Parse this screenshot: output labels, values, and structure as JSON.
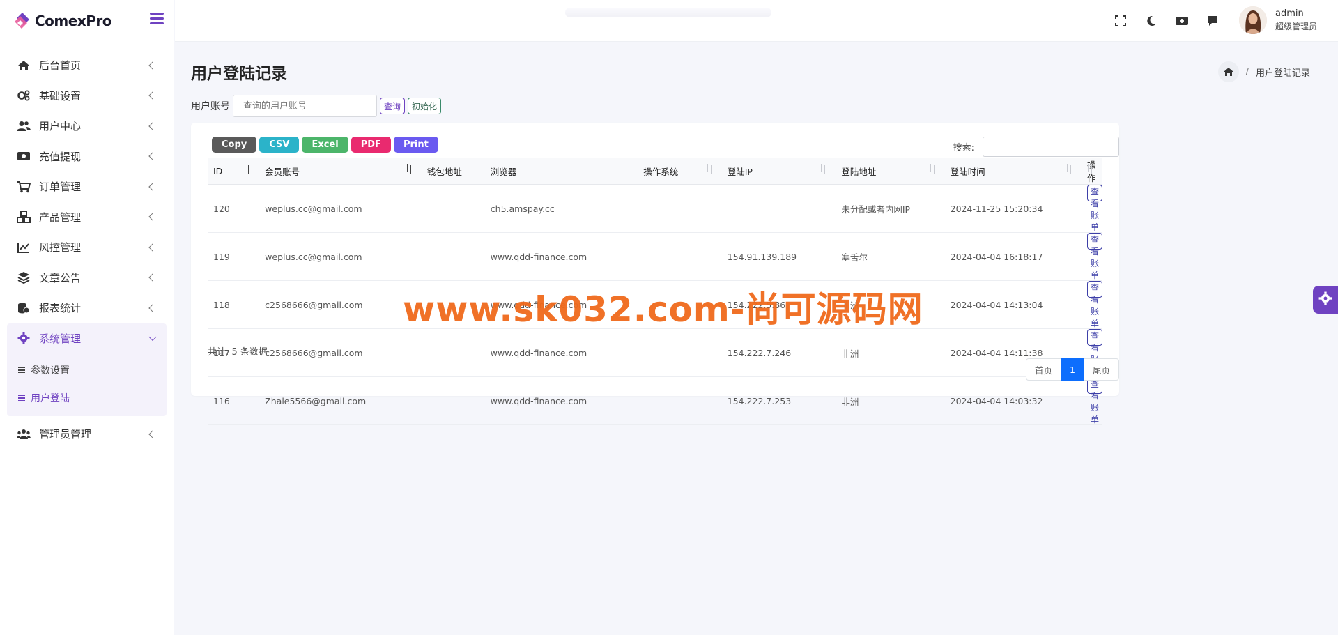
{
  "brand": {
    "name": "ComexPro"
  },
  "sidebar": {
    "items": [
      {
        "label": "后台首页",
        "icon": "home-icon"
      },
      {
        "label": "基础设置",
        "icon": "gears-icon"
      },
      {
        "label": "用户中心",
        "icon": "users-icon"
      },
      {
        "label": "充值提现",
        "icon": "money-icon"
      },
      {
        "label": "订单管理",
        "icon": "cart-icon"
      },
      {
        "label": "产品管理",
        "icon": "cubes-icon"
      },
      {
        "label": "风控管理",
        "icon": "chart-line-icon"
      },
      {
        "label": "文章公告",
        "icon": "layers-icon"
      },
      {
        "label": "报表统计",
        "icon": "coins-icon"
      },
      {
        "label": "系统管理",
        "icon": "gear-icon",
        "expanded": true
      },
      {
        "label": "管理员管理",
        "icon": "user-group-icon"
      }
    ],
    "submenu": [
      {
        "label": "参数设置"
      },
      {
        "label": "用户登陆",
        "selected": true
      }
    ]
  },
  "topbar": {
    "user": {
      "name": "admin",
      "role": "超级管理员"
    }
  },
  "page": {
    "title": "用户登陆记录",
    "breadcrumb": "用户登陆记录"
  },
  "filter": {
    "label": "用户账号",
    "placeholder": "查询的用户账号",
    "query_label": "查询",
    "reset_label": "初始化"
  },
  "toolbar": {
    "buttons": [
      {
        "label": "Copy",
        "color": "#5a5a5a"
      },
      {
        "label": "CSV",
        "color": "#2bb3c9"
      },
      {
        "label": "Excel",
        "color": "#4cb56a"
      },
      {
        "label": "PDF",
        "color": "#e92a6f"
      },
      {
        "label": "Print",
        "color": "#6a5af0"
      }
    ],
    "search_label": "搜索:"
  },
  "table": {
    "columns": [
      "ID",
      "会员账号",
      "钱包地址",
      "浏览器",
      "操作系统",
      "登陆IP",
      "登陆地址",
      "登陆时间",
      "操作"
    ],
    "rows": [
      {
        "id": "120",
        "account": "weplus.cc@gmail.com",
        "wallet": "",
        "browser": "ch5.amspay.cc",
        "os": "",
        "ip": "",
        "location": "未分配或者内网IP",
        "time": "2024-11-25 15:20:34",
        "action": "查看账单"
      },
      {
        "id": "119",
        "account": "weplus.cc@gmail.com",
        "wallet": "",
        "browser": "www.qdd-finance.com",
        "os": "",
        "ip": "154.91.139.189",
        "location": "塞舌尔",
        "time": "2024-04-04 16:18:17",
        "action": "查看账单"
      },
      {
        "id": "118",
        "account": "c2568666@gmail.com",
        "wallet": "",
        "browser": "www.qdd-finance.com",
        "os": "",
        "ip": "154.222.5.86",
        "location": "非洲",
        "time": "2024-04-04 14:13:04",
        "action": "查看账单"
      },
      {
        "id": "117",
        "account": "c2568666@gmail.com",
        "wallet": "",
        "browser": "www.qdd-finance.com",
        "os": "",
        "ip": "154.222.7.246",
        "location": "非洲",
        "time": "2024-04-04 14:11:38",
        "action": "查看账单"
      },
      {
        "id": "116",
        "account": "Zhale5566@gmail.com",
        "wallet": "",
        "browser": "www.qdd-finance.com",
        "os": "",
        "ip": "154.222.7.253",
        "location": "非洲",
        "time": "2024-04-04 14:03:32",
        "action": "查看账单"
      }
    ],
    "total_text": "共计: 5 条数据"
  },
  "pagination": {
    "first": "首页",
    "current": "1",
    "last": "尾页"
  },
  "watermark": {
    "text": "www.sk032.com-尚可源码网"
  }
}
